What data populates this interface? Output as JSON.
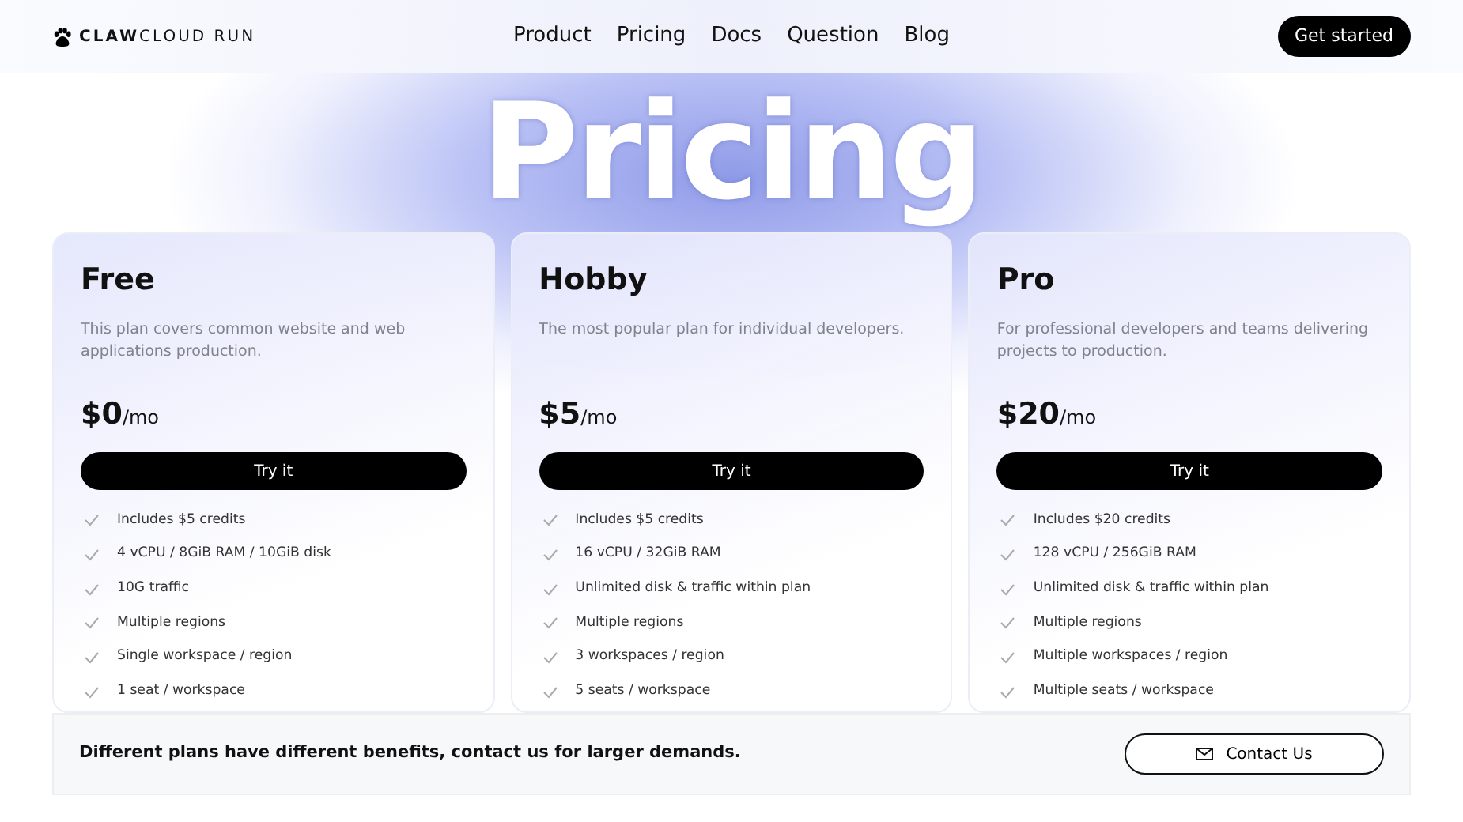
{
  "navbar": {
    "logo": "**CLAW**CLOUD RUN",
    "links": [
      "Product",
      "Pricing",
      "Docs",
      "Question",
      "Blog"
    ],
    "cta": "Get started"
  },
  "hero_title": "Pricing",
  "plans": [
    {
      "name": "Free",
      "description": "This plan covers common website and web applications production.",
      "price": "$0",
      "period": "/mo",
      "button": "Try it",
      "features": [
        "Includes $5 credits",
        "4 vCPU / 8GiB RAM / 10GiB disk",
        "10G traffic",
        "Multiple regions",
        "Single workspace / region",
        "1 seat / workspace"
      ]
    },
    {
      "name": "Hobby",
      "description": "The most popular plan for individual developers.",
      "price": "$5",
      "period": "/mo",
      "button": "Try it",
      "features": [
        "Includes $5 credits",
        "16 vCPU / 32GiB RAM",
        "Unlimited disk & traffic within plan",
        "Multiple regions",
        "3 workspaces / region",
        "5 seats / workspace"
      ]
    },
    {
      "name": "Pro",
      "description": "For professional developers and teams delivering projects to production.",
      "price": "$20",
      "period": "/mo",
      "button": "Try it",
      "features": [
        "Includes $20 credits",
        "128 vCPU / 256GiB RAM",
        "Unlimited disk & traffic within plan",
        "Multiple regions",
        "Multiple workspaces / region",
        "Multiple seats / workspace"
      ]
    }
  ],
  "contact_banner": {
    "text": "Different plans have different benefits, contact us for larger demands.",
    "button": "Contact Us"
  }
}
